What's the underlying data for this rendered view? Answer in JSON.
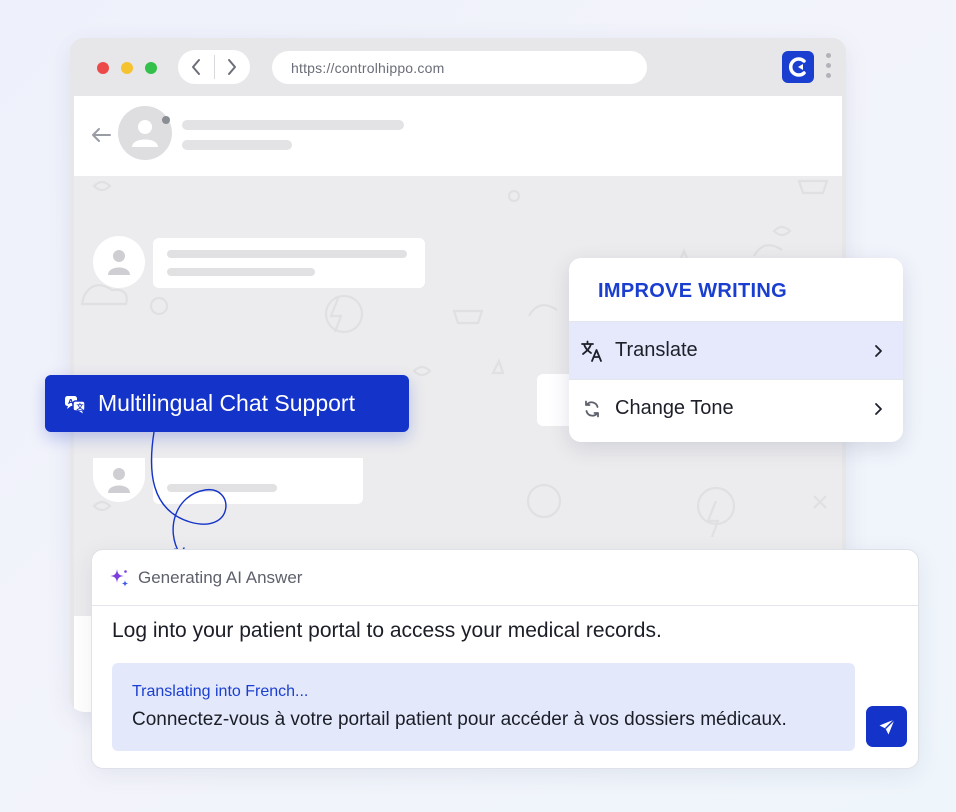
{
  "browser": {
    "url": "https://controlhippo.com",
    "dots": [
      "#ec4a4a",
      "#f6c330",
      "#33c04b"
    ],
    "brand_color": "#1a3fd0"
  },
  "menu": {
    "title": "IMPROVE WRITING",
    "items": [
      {
        "label": "Translate",
        "icon": "translate-icon",
        "active": true
      },
      {
        "label": "Change Tone",
        "icon": "refresh-icon",
        "active": false
      }
    ]
  },
  "badge": {
    "label": "Multilingual Chat Support",
    "icon": "chat-translate-icon"
  },
  "ai_panel": {
    "header": "Generating AI Answer",
    "answer": "Log into your patient portal to access your medical records.",
    "translation_status": "Translating into French...",
    "translation": "Connectez-vous à votre portail patient pour accéder à vos dossiers médicaux.",
    "send_icon": "send-icon"
  },
  "colors": {
    "accent": "#1433c9",
    "accent_light": "#e3e8fb",
    "ai_sparkle": "#7b3fe0"
  }
}
